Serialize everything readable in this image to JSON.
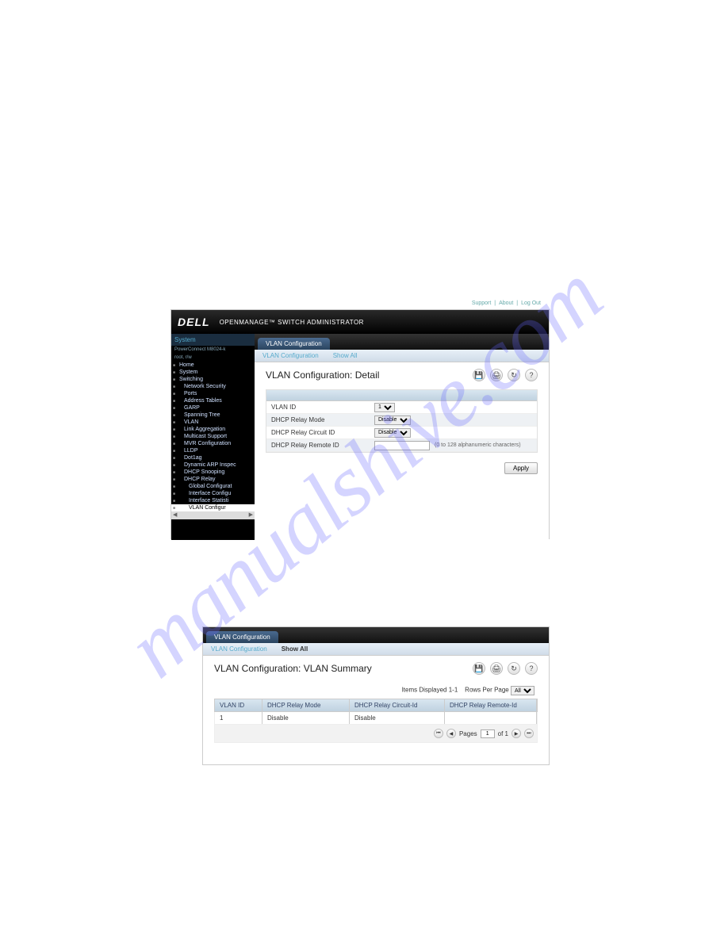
{
  "watermark": "manualshive.com",
  "header": {
    "logo": "DELL",
    "app_title": "OPENMANAGE™ SWITCH ADMINISTRATOR",
    "links": {
      "support": "Support",
      "about": "About",
      "logout": "Log Out"
    }
  },
  "sidebar": {
    "system_label": "System",
    "device": "PowerConnect M8024-k",
    "host": "root, r/w",
    "items": [
      "Home",
      "System",
      "Switching",
      "Network Security",
      "Ports",
      "Address Tables",
      "GARP",
      "Spanning Tree",
      "VLAN",
      "Link Aggregation",
      "Multicast Support",
      "MVR Configuration",
      "LLDP",
      "Dot1ag",
      "Dynamic ARP Inspec",
      "DHCP Snooping",
      "DHCP Relay",
      "Global Configurat",
      "Interface Configu",
      "Interface Statisti",
      "VLAN Configur"
    ]
  },
  "tabs": {
    "main": "VLAN Configuration",
    "sub1": "VLAN Configuration",
    "sub2": "Show All"
  },
  "detail": {
    "title": "VLAN Configuration: Detail",
    "rows": {
      "vlan_id": "VLAN ID",
      "relay_mode": "DHCP Relay Mode",
      "relay_circuit": "DHCP Relay Circuit ID",
      "relay_remote": "DHCP Relay Remote ID"
    },
    "vlan_id_val": "1",
    "relay_mode_val": "Disable",
    "relay_circuit_val": "Disable",
    "relay_remote_val": "",
    "remote_hint": "(0 to 128 alphanumeric characters)",
    "apply": "Apply"
  },
  "summary": {
    "title": "VLAN Configuration: VLAN Summary",
    "items_displayed": "Items Displayed 1-1",
    "rows_per_page": "Rows Per Page",
    "rows_per_page_val": "All",
    "cols": {
      "c1": "VLAN ID",
      "c2": "DHCP Relay Mode",
      "c3": "DHCP Relay Circuit-Id",
      "c4": "DHCP Relay Remote-Id"
    },
    "row1": {
      "c1": "1",
      "c2": "Disable",
      "c3": "Disable",
      "c4": ""
    },
    "pager": {
      "pages_label": "Pages",
      "page_val": "1",
      "of": "of 1"
    }
  },
  "toolbar": {
    "save": "💾",
    "print": "🖨",
    "refresh": "↻",
    "help": "?"
  },
  "chart_data": {
    "type": "table",
    "title": "VLAN Configuration: VLAN Summary",
    "columns": [
      "VLAN ID",
      "DHCP Relay Mode",
      "DHCP Relay Circuit-Id",
      "DHCP Relay Remote-Id"
    ],
    "rows": [
      [
        "1",
        "Disable",
        "Disable",
        ""
      ]
    ]
  }
}
